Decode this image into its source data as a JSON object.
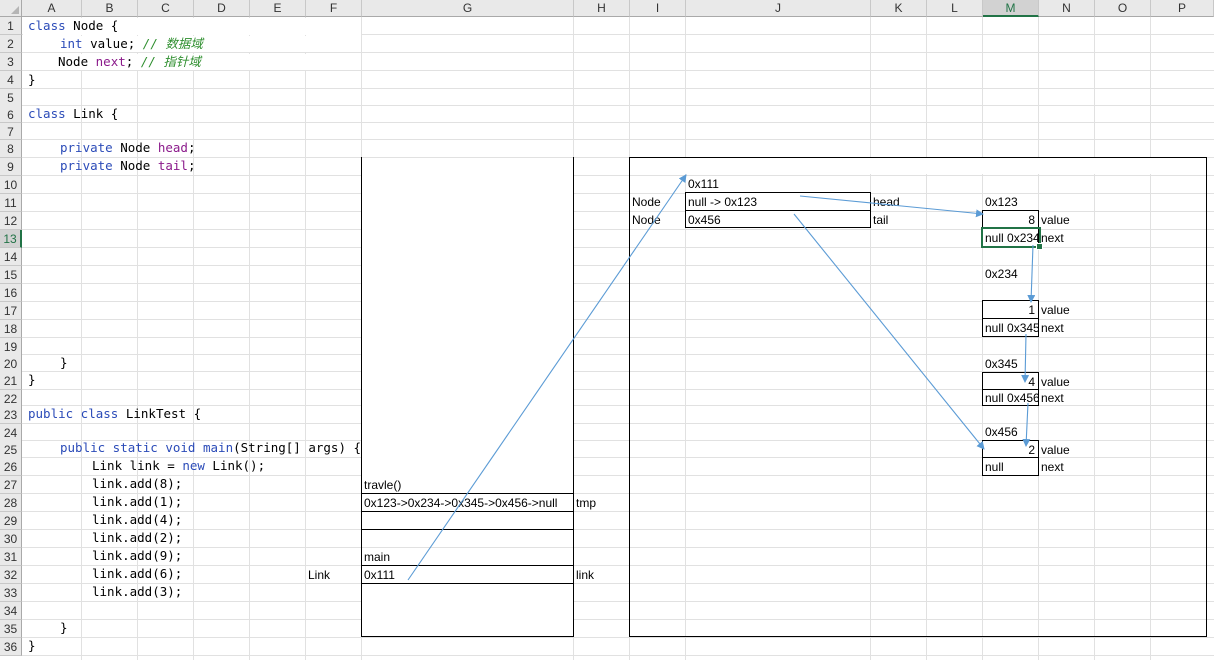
{
  "columns": [
    "A",
    "B",
    "C",
    "D",
    "E",
    "F",
    "G",
    "H",
    "I",
    "J",
    "K",
    "L",
    "M",
    "N",
    "O",
    "P"
  ],
  "rows": [
    "1",
    "2",
    "3",
    "4",
    "5",
    "6",
    "7",
    "8",
    "9",
    "10",
    "11",
    "12",
    "13",
    "14",
    "15",
    "16",
    "17",
    "18",
    "19",
    "20",
    "21",
    "22",
    "23",
    "24",
    "25",
    "26",
    "27",
    "28",
    "29",
    "30",
    "31",
    "32",
    "33",
    "34",
    "35",
    "36"
  ],
  "selected_column": "M",
  "selected_row": "13",
  "code": {
    "l1_a": "class",
    "l1_b": " Node {",
    "l2_a": "int",
    "l2_b": " value; ",
    "l2_c": "// 数据域",
    "l3_a": "Node ",
    "l3_b": "next",
    "l3_c": "; ",
    "l3_d": "// 指针域",
    "l4": "}",
    "l6_a": "class",
    "l6_b": " Link {",
    "l8_a": "private",
    "l8_b": " Node ",
    "l8_c": "head",
    "l8_d": ";",
    "l9_a": "private",
    "l9_b": " Node ",
    "l9_c": "tail",
    "l9_d": ";",
    "l20": "}",
    "l21": "}",
    "l23_a": "public class",
    "l23_b": " LinkTest {",
    "l25_a": "public static void main",
    "l25_b": "(String[] args) {",
    "l26_a": "Link link = ",
    "l26_b": "new",
    "l26_c": " Link();",
    "add_calls": [
      "link.add(8);",
      "link.add(1);",
      "link.add(4);",
      "link.add(2);",
      "link.add(9);",
      "link.add(6);",
      "link.add(3);"
    ],
    "l35": "}",
    "l36": "}"
  },
  "stack": {
    "travle_label": "travle()",
    "tmp_value": "0x123->0x234->0x345->0x456->null",
    "tmp_label": "tmp",
    "main_label": "main",
    "link_type": "Link",
    "link_value": "0x111",
    "link_label": "link"
  },
  "heap": {
    "link_obj_addr": "0x111",
    "head_type": "Node",
    "head_value": "null -> 0x123",
    "head_label": "head",
    "tail_type": "Node",
    "tail_value": "0x456",
    "tail_label": "tail",
    "nodes": [
      {
        "addr": "0x123",
        "value": "8",
        "next": "null 0x234"
      },
      {
        "addr": "0x234",
        "value": "1",
        "next": "null 0x345"
      },
      {
        "addr": "0x345",
        "value": "4",
        "next": "null 0x456"
      },
      {
        "addr": "0x456",
        "value": "2",
        "next": "null"
      }
    ],
    "value_label": "value",
    "next_label": "next"
  },
  "colors": {
    "arrow": "#5b9bd5",
    "selection": "#217346",
    "keyword": "#2b4bb8",
    "field": "#8b1a8b",
    "comment": "#2f8f2f"
  }
}
